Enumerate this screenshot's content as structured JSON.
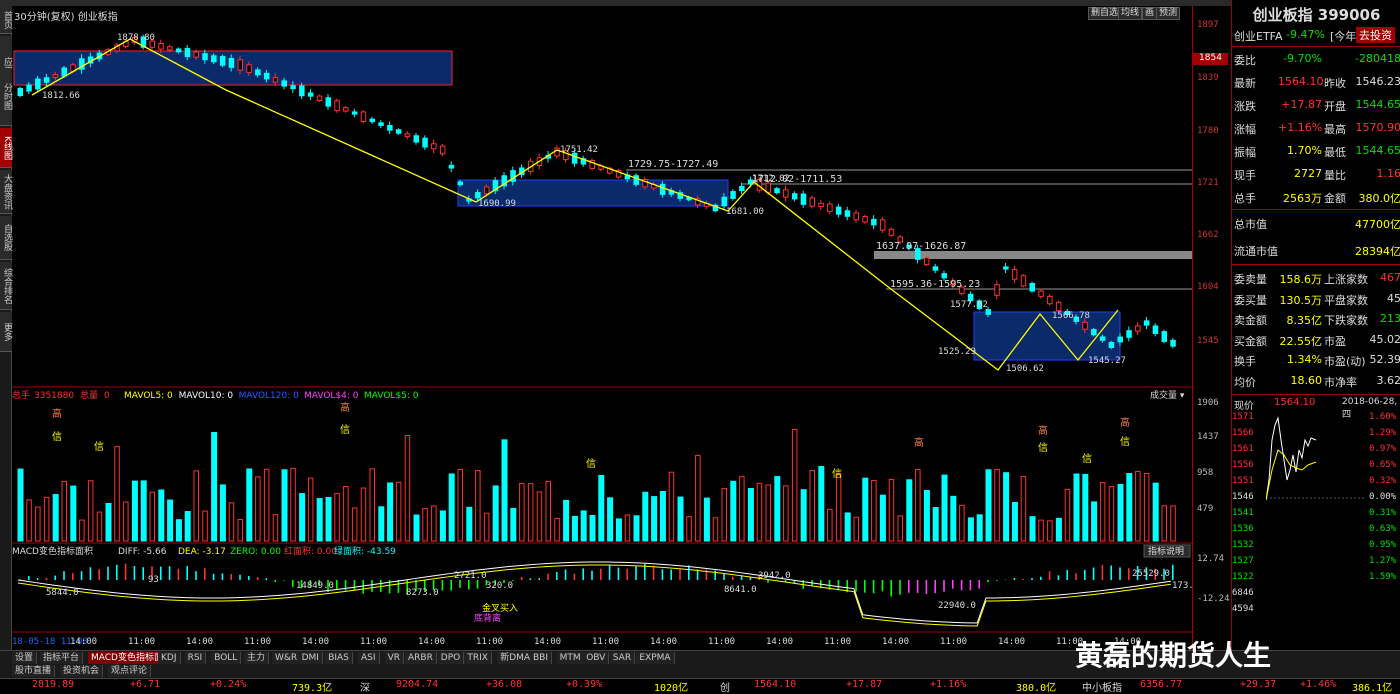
{
  "chart_header": {
    "title": "30分钟(复权)  创业板指",
    "buttons": [
      "删自选",
      "均线",
      "画",
      "预测"
    ]
  },
  "left_tabs": [
    "首页",
    "应用",
    "分时图",
    "K线图",
    "大盘资讯",
    "自选股",
    "综合排名",
    "更多"
  ],
  "price_axis": [
    "1897",
    "1854",
    "1839",
    "1780",
    "1721",
    "1662",
    "1604",
    "1545"
  ],
  "current_price_tag": "1854",
  "vol_axis": [
    "1906",
    "1437",
    "958",
    "479"
  ],
  "macd_axis": [
    "12.74",
    "-12.24"
  ],
  "time_labels": [
    "18-05-18 11:00",
    "14:00",
    "11:00",
    "14:00",
    "11:00",
    "14:00",
    "11:00",
    "14:00",
    "11:00",
    "14:00",
    "11:00",
    "14:00",
    "11:00",
    "14:00",
    "11:00",
    "14:00",
    "11:00",
    "14:00",
    "11:00",
    "14:00"
  ],
  "annotations": {
    "pivots": [
      "1812.66",
      "1878.80",
      "1690.99",
      "1751.42",
      "1681.00",
      "1712.02",
      "1525.29",
      "1577.62",
      "1506.62",
      "1566.78",
      "1545.27"
    ],
    "ranges": [
      "1729.75-1727.49",
      "1712.02-1711.53",
      "1637.97-1626.87",
      "1595.36-1595.23"
    ]
  },
  "vol_header": {
    "total_label": "总手",
    "total_value": "3351880",
    "total_state_label": "总量",
    "total_state": "0",
    "items": [
      "MAVOL5: 0",
      "MAVOL10: 0",
      "MAVOL120: 0",
      "MAVOL$4: 0",
      "MAVOL$5: 0"
    ],
    "dropdown": "成交量"
  },
  "vol_marks": [
    "高",
    "信",
    "信",
    "高",
    "信",
    "信",
    "信",
    "高",
    "高",
    "信",
    "信",
    "高",
    "信"
  ],
  "macd_header": {
    "name": "MACD变色指标面积",
    "diff": "DIFF: -5.66",
    "dea": "DEA: -3.17",
    "zero": "ZERO: 0.00",
    "red_area": "红面积: 0.00",
    "green_area": "绿面积: -43.59",
    "btn": "指标说明"
  },
  "macd_labels": [
    "5844.0",
    "93",
    "14849.0",
    "8273.0",
    "2721.0",
    "320.0",
    "金叉买入",
    "底背离",
    "3942.0",
    "8641.0",
    "22940.0",
    "25529.0",
    "173.0"
  ],
  "bottom_tabs": [
    "设置",
    "指标平台",
    "MACD变色指标面积",
    "KDJ",
    "RSI",
    "BOLL",
    "主力",
    "W&R",
    "DMI",
    "BIAS",
    "ASI",
    "VR",
    "ARBR",
    "DPO",
    "TRIX",
    "新DMA",
    "BBI",
    "MTM",
    "OBV",
    "SAR",
    "EXPMA"
  ],
  "bottom_tabs2": [
    "股市直播",
    "投资机会",
    "观点评论"
  ],
  "ticker": [
    {
      "t": "2819.89",
      "c": "red"
    },
    {
      "t": "+6.71",
      "c": "red"
    },
    {
      "t": "+0.24%",
      "c": "red"
    },
    {
      "t": "739.3亿",
      "c": "yellow"
    },
    {
      "t": "深",
      "c": "white"
    },
    {
      "t": "9204.74",
      "c": "red"
    },
    {
      "t": "+36.08",
      "c": "red"
    },
    {
      "t": "+0.39%",
      "c": "red"
    },
    {
      "t": "1020亿",
      "c": "yellow"
    },
    {
      "t": "创",
      "c": "white"
    },
    {
      "t": "1564.10",
      "c": "red"
    },
    {
      "t": "+17.87",
      "c": "red"
    },
    {
      "t": "+1.16%",
      "c": "red"
    },
    {
      "t": "380.0亿",
      "c": "yellow"
    },
    {
      "t": "中小板指",
      "c": "white"
    },
    {
      "t": "6356.77",
      "c": "red"
    },
    {
      "t": "+29.37",
      "c": "red"
    },
    {
      "t": "+1.46%",
      "c": "red"
    },
    {
      "t": "386.1亿",
      "c": "yellow"
    }
  ],
  "right_panel": {
    "title": "创业板指 399006",
    "etf": {
      "label": "创业ETFA",
      "value": "-9.47%",
      "tag": "[今年]",
      "btn": "去投资"
    },
    "rows": [
      {
        "l": "委比",
        "v": "-9.70%",
        "vc": "green",
        "l2": "",
        "v2": "-280418",
        "v2c": "green"
      },
      {
        "l": "最新",
        "v": "1564.10",
        "vc": "red",
        "l2": "昨收",
        "v2": "1546.23",
        "v2c": "white"
      },
      {
        "l": "涨跌",
        "v": "+17.87",
        "vc": "red",
        "l2": "开盘",
        "v2": "1544.65",
        "v2c": "green"
      },
      {
        "l": "涨幅",
        "v": "+1.16%",
        "vc": "red",
        "l2": "最高",
        "v2": "1570.90",
        "v2c": "red"
      },
      {
        "l": "振幅",
        "v": "1.70%",
        "vc": "yellow",
        "l2": "最低",
        "v2": "1544.65",
        "v2c": "green"
      },
      {
        "l": "现手",
        "v": "2727",
        "vc": "yellow",
        "l2": "量比",
        "v2": "1.16",
        "v2c": "red"
      },
      {
        "l": "总手",
        "v": "2563万",
        "vc": "yellow",
        "l2": "金额",
        "v2": "380.0亿",
        "v2c": "yellow"
      }
    ],
    "rows2": [
      {
        "l": "总市值",
        "v2": "47700亿",
        "v2c": "yellow"
      },
      {
        "l": "流通市值",
        "v2": "28394亿",
        "v2c": "yellow"
      }
    ],
    "rows3": [
      {
        "l": "委卖量",
        "v": "158.6万",
        "vc": "yellow",
        "l2": "上涨家数",
        "v2": "467",
        "v2c": "red"
      },
      {
        "l": "委买量",
        "v": "130.5万",
        "vc": "yellow",
        "l2": "平盘家数",
        "v2": "45",
        "v2c": "white"
      },
      {
        "l": "卖金额",
        "v": "8.35亿",
        "vc": "yellow",
        "l2": "下跌家数",
        "v2": "213",
        "v2c": "green"
      },
      {
        "l": "买金额",
        "v": "22.55亿",
        "vc": "yellow",
        "l2": "市盈",
        "v2": "45.02",
        "v2c": "white"
      },
      {
        "l": "换手",
        "v": "1.34%",
        "vc": "yellow",
        "l2": "市盈(动)",
        "v2": "52.39",
        "v2c": "white"
      },
      {
        "l": "均价",
        "v": "18.60",
        "vc": "yellow",
        "l2": "市净率",
        "v2": "3.62",
        "v2c": "white"
      }
    ],
    "mini": {
      "label": "现价",
      "price": "1564.10",
      "date": "2018-06-28,四",
      "left_axis": [
        "1571",
        "1566",
        "1561",
        "1556",
        "1551",
        "1546",
        "1541",
        "1536",
        "1532",
        "1527",
        "1522",
        "6846",
        "4594"
      ],
      "right_axis": [
        "1.60%",
        "1.29%",
        "0.97%",
        "0.65%",
        "0.32%",
        "0.00%",
        "0.31%",
        "0.63%",
        "0.95%",
        "1.27%",
        "1.59%"
      ]
    }
  },
  "watermark": "黄磊的期货人生"
}
